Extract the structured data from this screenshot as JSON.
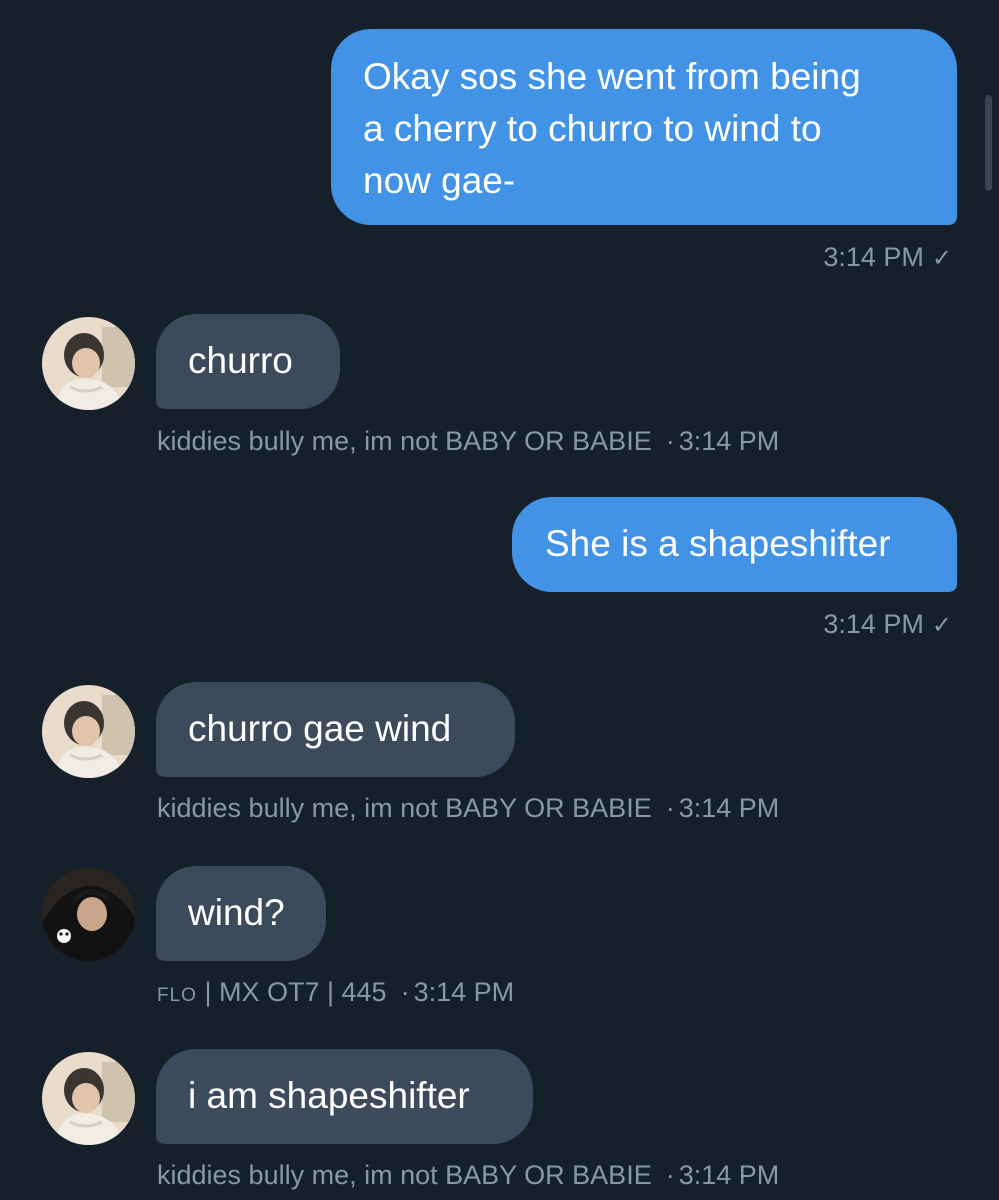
{
  "messages": [
    {
      "direction": "sent",
      "lines": [
        "Okay sos she went from being",
        "a cherry to churro to wind to",
        "now gae-"
      ],
      "time": "3:14 PM",
      "status_icon": "checkmark-icon"
    },
    {
      "direction": "received",
      "text": "churro",
      "sender": "kiddies bully me, im not BABY OR BABIE",
      "time": "3:14 PM",
      "avatar": "avatar-light-photo"
    },
    {
      "direction": "sent",
      "text": "She is a shapeshifter",
      "time": "3:14 PM",
      "status_icon": "checkmark-icon"
    },
    {
      "direction": "received",
      "text": "churro gae wind",
      "sender": "kiddies bully me, im not BABY OR BABIE",
      "time": "3:14 PM",
      "avatar": "avatar-light-photo"
    },
    {
      "direction": "received",
      "text": "wind?",
      "sender_prefix": "FLO",
      "sender": "| MX OT7 | 445",
      "time": "3:14 PM",
      "avatar": "avatar-dark-photo"
    },
    {
      "direction": "received",
      "text": "i am shapeshifter",
      "sender": "kiddies bully me, im not BABY OR BABIE",
      "time": "3:14 PM",
      "avatar": "avatar-light-photo"
    }
  ],
  "separator": "·",
  "check_glyph": "✓",
  "colors": {
    "background": "#15202b",
    "sent_bubble": "#4293e6",
    "received_bubble": "#3c4b5c",
    "meta_text": "#8899a6",
    "bubble_text": "#ffffff"
  }
}
